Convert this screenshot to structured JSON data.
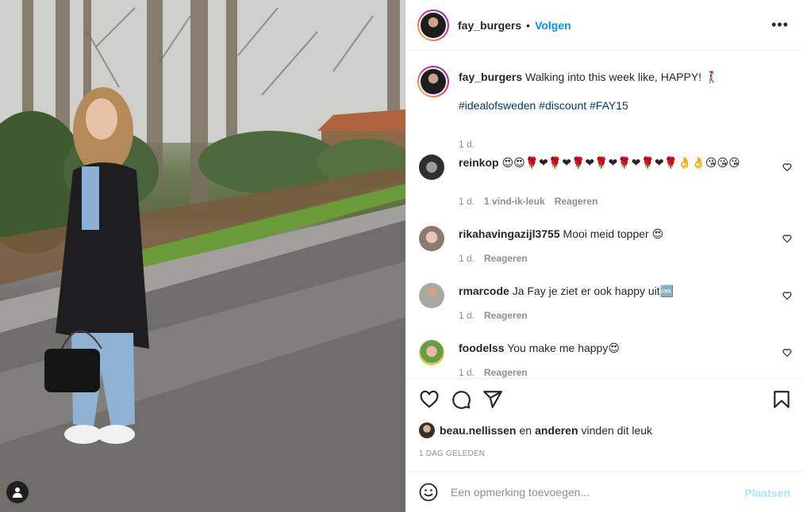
{
  "post": {
    "author": "fay_burgers",
    "separator": "•",
    "follow_label": "Volgen",
    "more_label": "•••",
    "caption_text": "Walking into this week like, HAPPY! 🚶‍♀️",
    "hashtags": "#idealofsweden #discount #FAY15",
    "caption_time": "1 d."
  },
  "comments": [
    {
      "user": "reinkop",
      "text": "😍😍🌹❤🌹❤🌹❤🌹❤🌹❤🌹❤🌹👌👌😘😘😘",
      "time": "1 d.",
      "likes": "1 vind-ik-leuk",
      "reply": "Reageren"
    },
    {
      "user": "rikahavingazijl3755",
      "text": "Mooi meid topper 😍",
      "time": "1 d.",
      "reply": "Reageren"
    },
    {
      "user": "rmarcode",
      "text": "Ja Fay je ziet er ook happy uit🆒",
      "time": "1 d.",
      "reply": "Reageren"
    },
    {
      "user": "foodelss",
      "text": "You make me happy😍",
      "time": "1 d.",
      "reply": "Reageren"
    }
  ],
  "likes_line": {
    "user": "beau.nellissen",
    "joiner": "en",
    "others": "anderen",
    "suffix": "vinden dit leuk"
  },
  "timestamp": "1 DAG GELEDEN",
  "compose": {
    "placeholder": "Een opmerking toevoegen...",
    "post_label": "Plaatsen"
  },
  "icons": [
    "heart-icon",
    "comment-icon",
    "share-icon",
    "bookmark-icon",
    "smiley-icon",
    "user-tag-icon",
    "more-icon"
  ],
  "colors": {
    "accent": "#0095f6",
    "hashtag": "#00376b",
    "muted": "#8e8e8e",
    "post_disabled": "#b2dffc"
  }
}
